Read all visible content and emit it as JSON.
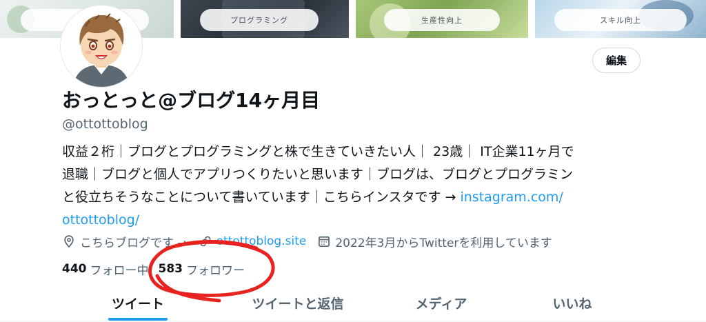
{
  "banner": {
    "tiles": [
      {
        "label": ""
      },
      {
        "label": "プログラミング"
      },
      {
        "label": "生産性向上"
      },
      {
        "label": "スキル向上"
      }
    ]
  },
  "profile": {
    "edit_label": "編集",
    "display_name": "おっとっと@ブログ14ヶ月目",
    "handle": "@ottottoblog",
    "bio_lines": [
      "収益２桁｜ブログとプログラミングと株で生きていきたい人｜ 23歳｜ IT企業11ヶ月で",
      "退職｜ブログと個人でアプリつくりたいと思います｜ブログは、ブログとプログラミン",
      "と役立ちそうなことについて書いています｜こちらインスタです → "
    ],
    "bio_link_part1": "instagram.com/",
    "bio_link_part2": "ottottoblog/",
    "location": "こちらブログです →",
    "website": "ottottoblog.site",
    "joined": "2022年3月からTwitterを利用しています",
    "following_count": "440",
    "following_label": "フォロー中",
    "followers_count": "583",
    "followers_label": "フォロワー"
  },
  "tabs": [
    {
      "label": "ツイート",
      "active": true
    },
    {
      "label": "ツイートと返信",
      "active": false
    },
    {
      "label": "メディア",
      "active": false
    },
    {
      "label": "いいね",
      "active": false
    }
  ],
  "colors": {
    "accent": "#1d9bf0",
    "text_primary": "#0f1419",
    "text_secondary": "#536471",
    "annotation": "#e8231f"
  },
  "icons": {
    "location": "location-pin-icon",
    "website": "link-icon",
    "joined": "calendar-icon"
  }
}
